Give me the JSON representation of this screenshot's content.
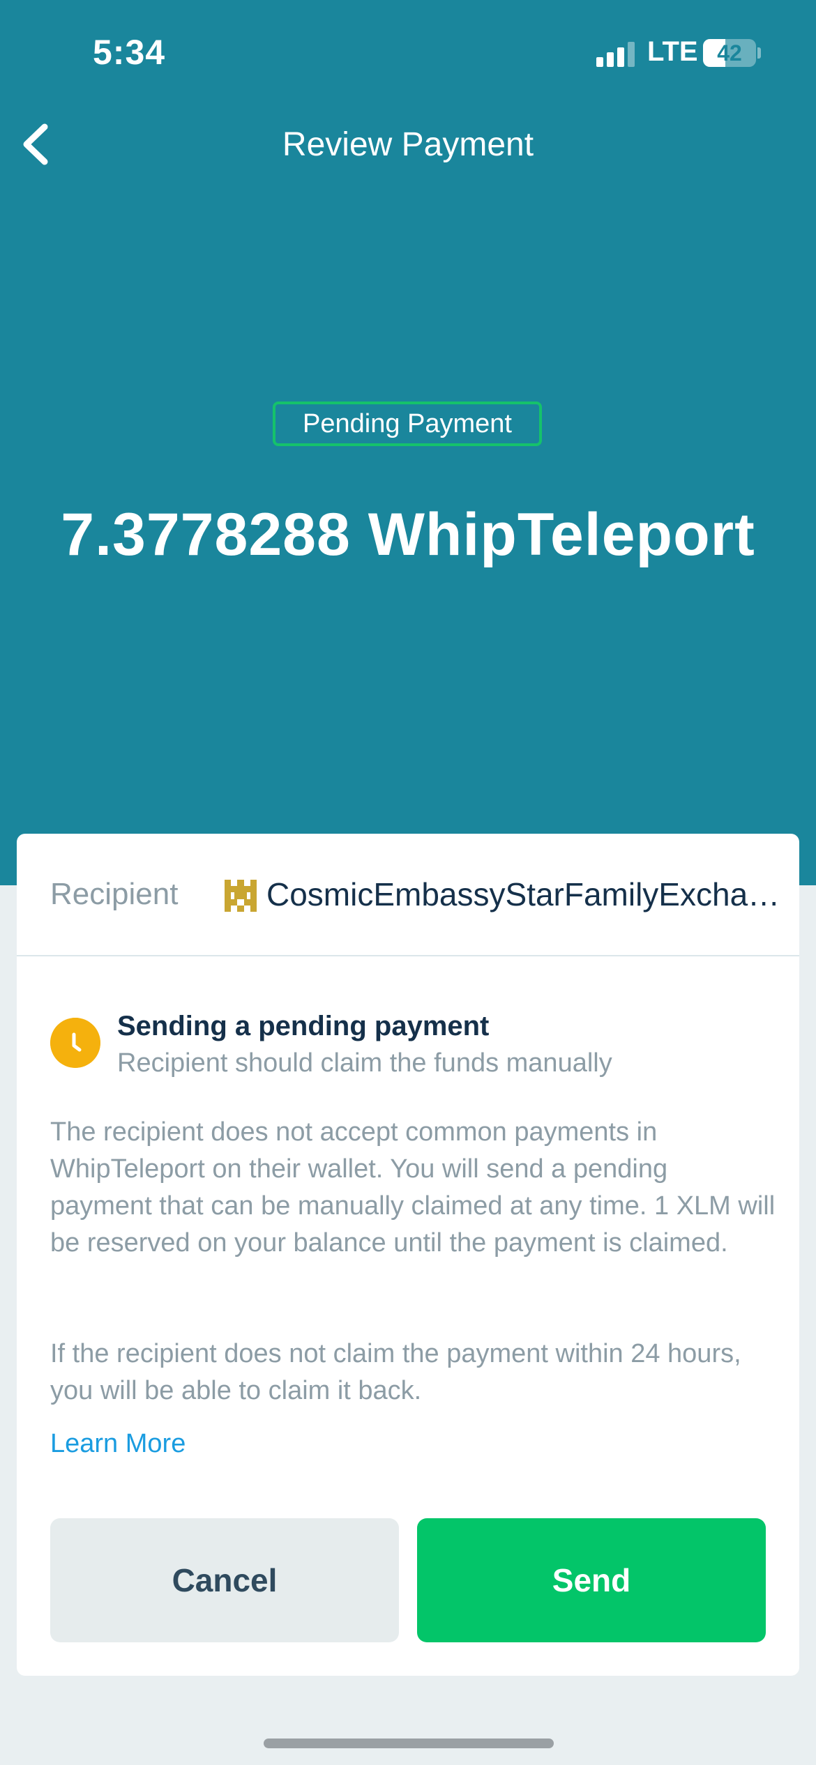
{
  "status_bar": {
    "time": "5:34",
    "network": "LTE",
    "battery_level": 42,
    "battery_text": "42"
  },
  "nav": {
    "title": "Review Payment",
    "back_icon": "chevron-left-icon"
  },
  "payment": {
    "badge": "Pending Payment",
    "amount": "7.3778288 WhipTeleport"
  },
  "recipient": {
    "label": "Recipient",
    "avatar_icon": "identicon-icon",
    "name": "CosmicEmbassyStarFamilyExcha…"
  },
  "notice": {
    "icon": "clock-icon",
    "title": "Sending a pending payment",
    "subtitle": "Recipient should claim the funds manually",
    "paragraph_1": "The recipient does not accept common payments in WhipTeleport on their wallet. You will send a pending payment that can be manually claimed at any time. 1 XLM will be reserved on your balance until the payment is claimed.",
    "paragraph_2": "If the recipient does not claim the payment within 24 hours, you will be able to claim it back.",
    "learn_more": "Learn More"
  },
  "actions": {
    "cancel_label": "Cancel",
    "send_label": "Send"
  },
  "colors": {
    "header_bg": "#1a869c",
    "badge_border": "#15c26b",
    "send_button": "#03c569",
    "cancel_button": "#e6eced",
    "clock_icon": "#f5b10d",
    "link": "#1a9ce0",
    "page_bg": "#e9eff1"
  }
}
